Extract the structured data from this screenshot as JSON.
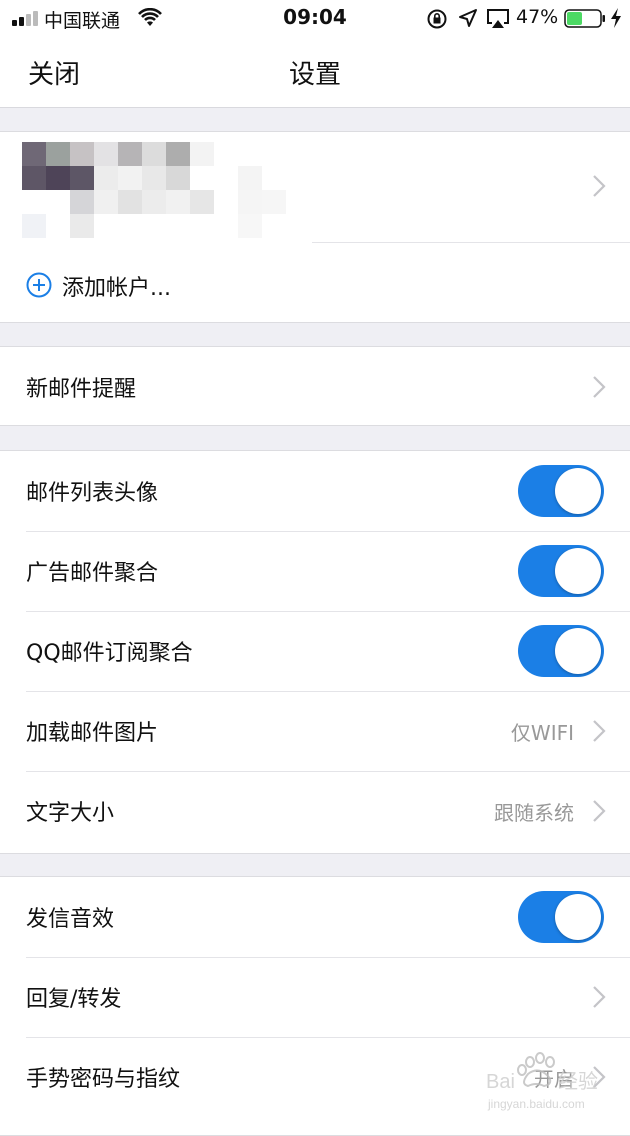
{
  "status_bar": {
    "carrier": "中国联通",
    "time": "09:04",
    "battery_percent": "47%",
    "battery_level": 0.47,
    "icons": [
      "signal-icon",
      "wifi-icon",
      "rotation-lock-icon",
      "location-icon",
      "airplay-icon",
      "battery-icon",
      "charging-icon"
    ]
  },
  "nav": {
    "close_label": "关闭",
    "title": "设置"
  },
  "account": {
    "add_label": "添加帐户..."
  },
  "rows": {
    "new_mail_alert": {
      "label": "新邮件提醒"
    },
    "list_avatar": {
      "label": "邮件列表头像",
      "on": true
    },
    "ad_aggregate": {
      "label": "广告邮件聚合",
      "on": true
    },
    "qq_subscribe": {
      "label": "QQ邮件订阅聚合",
      "on": true
    },
    "load_images": {
      "label": "加载邮件图片",
      "value": "仅WIFI"
    },
    "font_size": {
      "label": "文字大小",
      "value": "跟随系统"
    },
    "send_sound": {
      "label": "发信音效",
      "on": true
    },
    "reply_forward": {
      "label": "回复/转发"
    },
    "gesture_password": {
      "label": "手势密码与指纹",
      "value": "开启"
    }
  },
  "colors": {
    "accent": "#1b7fe6",
    "background": "#efeff4",
    "battery": "#4cd964"
  }
}
